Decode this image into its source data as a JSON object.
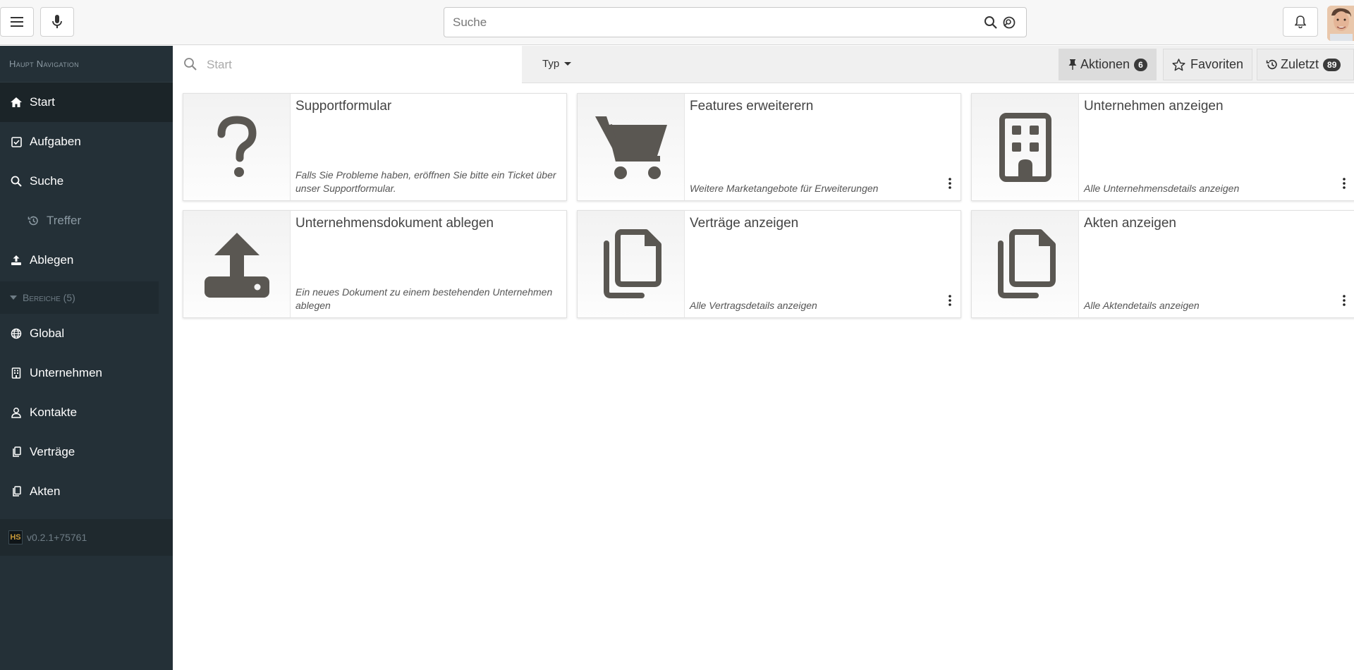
{
  "topbar": {
    "search_placeholder": "Suche",
    "menu_icon": "hamburger-icon",
    "mic_icon": "microphone-icon",
    "bell_icon": "bell-icon"
  },
  "sidebar": {
    "header": "Haupt Navigation",
    "items": [
      {
        "label": "Start",
        "icon": "home-icon"
      },
      {
        "label": "Aufgaben",
        "icon": "checkbox-icon"
      },
      {
        "label": "Suche",
        "icon": "search-icon"
      },
      {
        "label": "Treffer",
        "icon": "history-icon"
      },
      {
        "label": "Ablegen",
        "icon": "upload-icon"
      },
      {
        "label": "Global",
        "icon": "globe-icon"
      },
      {
        "label": "Unternehmen",
        "icon": "building-icon"
      },
      {
        "label": "Kontakte",
        "icon": "user-icon"
      },
      {
        "label": "Verträge",
        "icon": "copy-icon"
      },
      {
        "label": "Akten",
        "icon": "copy-icon"
      }
    ],
    "group_label": "Bereiche (5)",
    "version_badge": "HS",
    "version": "v0.2.1+75761"
  },
  "toolbar": {
    "filter_placeholder": "Start",
    "type_label": "Typ",
    "aktionen_label": "Aktionen",
    "aktionen_count": "6",
    "favoriten_label": "Favoriten",
    "zuletzt_label": "Zuletzt",
    "zuletzt_count": "89"
  },
  "cards": [
    {
      "title": "Supportformular",
      "desc": "Falls Sie Probleme haben, eröffnen Sie bitte ein Ticket über unser Supportformular.",
      "icon": "question-icon"
    },
    {
      "title": "Features erweiterern",
      "desc": "Weitere Marketangebote für Erweiterungen",
      "icon": "cart-icon"
    },
    {
      "title": "Unternehmen anzeigen",
      "desc": "Alle Unternehmensdetails anzeigen",
      "icon": "building-icon"
    },
    {
      "title": "Unternehmensdokument ablegen",
      "desc": "Ein neues Dokument zu einem bestehenden Unternehmen ablegen",
      "icon": "upload-icon"
    },
    {
      "title": "Verträge anzeigen",
      "desc": "Alle Vertragsdetails anzeigen",
      "icon": "copy-icon"
    },
    {
      "title": "Akten anzeigen",
      "desc": "Alle Aktendetails anzeigen",
      "icon": "copy-icon"
    }
  ]
}
